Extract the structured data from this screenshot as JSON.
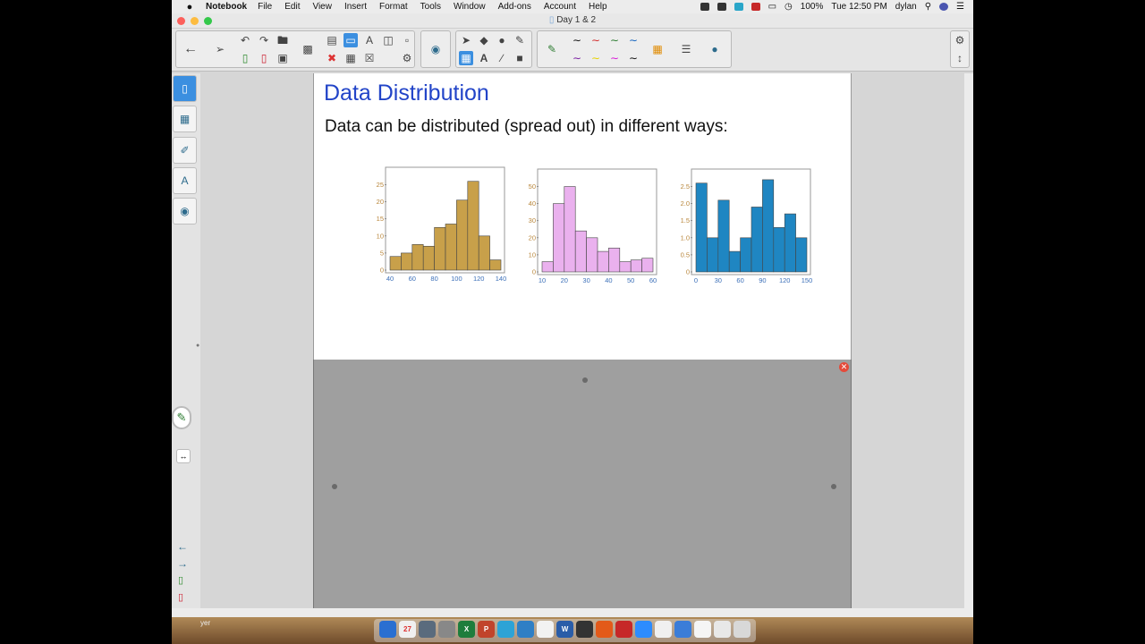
{
  "menubar": {
    "app_name": "Notebook",
    "items": [
      "File",
      "Edit",
      "View",
      "Insert",
      "Format",
      "Tools",
      "Window",
      "Add-ons",
      "Account",
      "Help"
    ],
    "battery": "100%",
    "clock": "Tue 12:50 PM",
    "user": "dylan"
  },
  "window": {
    "title": "Day 1 & 2"
  },
  "page": {
    "title": "Data Distribution",
    "text": "Data can be distributed (spread out) in different ways:"
  },
  "dock": {
    "label": "yer"
  },
  "chart_data": [
    {
      "type": "bar",
      "x_ticks": [
        "40",
        "60",
        "80",
        "100",
        "120",
        "140"
      ],
      "y_ticks": [
        "0",
        "5",
        "10",
        "15",
        "20",
        "25"
      ],
      "bin_start": 40,
      "bin_width": 10,
      "values": [
        4,
        5,
        7.5,
        7,
        12.5,
        13.5,
        20.5,
        26,
        10,
        3
      ],
      "ylim": [
        0,
        27.5
      ],
      "color": "#c8a04a"
    },
    {
      "type": "bar",
      "x_ticks": [
        "10",
        "20",
        "30",
        "40",
        "50",
        "60"
      ],
      "y_ticks": [
        "0",
        "10",
        "20",
        "30",
        "40",
        "50"
      ],
      "bin_start": 10,
      "bin_width": 5,
      "values": [
        6,
        40,
        50,
        24,
        20,
        12,
        14,
        6,
        7,
        8
      ],
      "ylim": [
        0,
        55
      ],
      "color": "#eab1ee"
    },
    {
      "type": "bar",
      "x_ticks": [
        "0",
        "30",
        "60",
        "90",
        "120",
        "150"
      ],
      "y_ticks": [
        "0",
        "0.5",
        "1.0",
        "1.5",
        "2.0",
        "2.5"
      ],
      "bin_start": 0,
      "bin_width": 15,
      "values": [
        2.6,
        1.0,
        2.1,
        0.6,
        1.0,
        1.9,
        2.7,
        1.3,
        1.7,
        1.0
      ],
      "ylim": [
        0,
        2.75
      ],
      "color": "#1f86c2"
    }
  ]
}
